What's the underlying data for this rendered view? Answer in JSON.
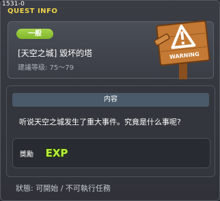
{
  "window": {
    "id": "1531-0",
    "title": "QUEST INFO"
  },
  "header": {
    "category": "一般",
    "quest_name": "[天空之城] 毀坏的塔",
    "level": "建議等级: 75～79",
    "sign_icon": "warning-signboard-icon",
    "sign_text": "WARNING"
  },
  "content": {
    "heading": "内容",
    "description": "听说天空之城发生了重大事件。究竟是什么事呢?",
    "reward_label": "獎勵",
    "reward_icon": "exp-icon",
    "reward_text": "EXP"
  },
  "status": "狀態: 可開始 / 不可執行任務",
  "colors": {
    "title": "#f0d44a",
    "badge_green": "#8cc63f",
    "exp_green": "#b8f03a",
    "sign_wood": "#c47a34"
  }
}
